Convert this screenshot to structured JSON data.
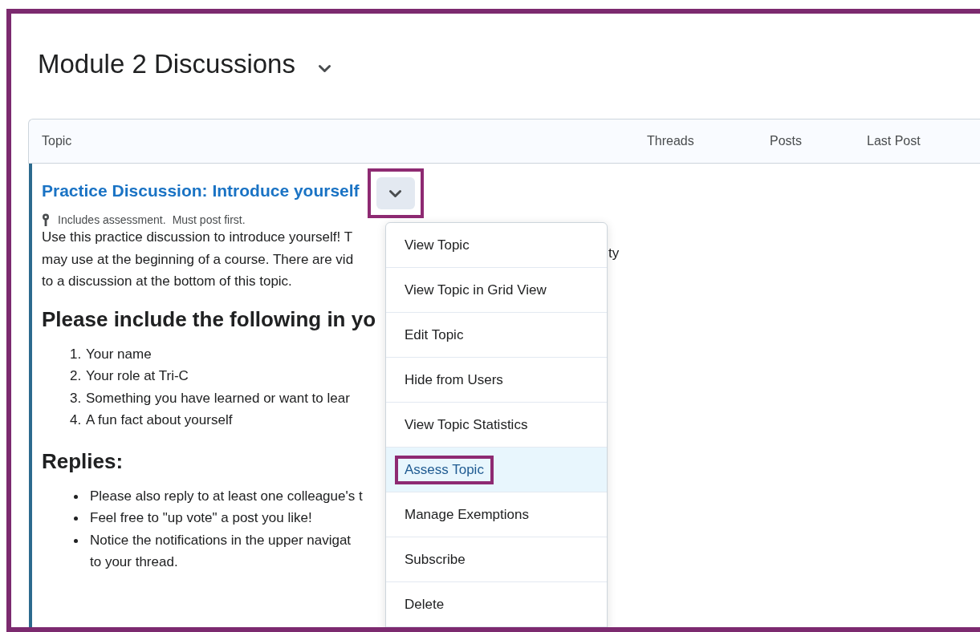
{
  "page": {
    "title": "Module 2 Discussions"
  },
  "table": {
    "columns": [
      "Topic",
      "Threads",
      "Posts",
      "Last Post"
    ]
  },
  "topic": {
    "title": "Practice Discussion: Introduce yourself",
    "menu_button": {
      "highlighted": true
    },
    "meta": [
      "Includes assessment.",
      "Must post first."
    ],
    "intro_lines": [
      "Use this practice discussion to introduce yourself! T",
      "may use at the beginning of a course. There are vid",
      "to a discussion at the bottom of this topic."
    ],
    "intro_fragment": "ty",
    "heading": "Please include the following in yo",
    "numbered": [
      {
        "number": "1.",
        "text": "Your name"
      },
      {
        "number": "2.",
        "text": "Your role at Tri-C"
      },
      {
        "number": "3.",
        "text": "Something you have learned or want to lear"
      },
      {
        "number": "4.",
        "text": "A fun fact about yourself"
      }
    ],
    "replies_heading": "Replies:",
    "bullets": [
      [
        "Please also reply to at least one colleague's t"
      ],
      [
        "Feel free to \"up vote\" a post you like!"
      ],
      [
        "Notice the notifications in the upper navigat",
        "to your thread."
      ]
    ]
  },
  "menu": {
    "items": [
      {
        "label": "View Topic",
        "selected": false,
        "highlighted": false
      },
      {
        "label": "View Topic in Grid View",
        "selected": false,
        "highlighted": false
      },
      {
        "label": "Edit Topic",
        "selected": false,
        "highlighted": false
      },
      {
        "label": "Hide from Users",
        "selected": false,
        "highlighted": false
      },
      {
        "label": "View Topic Statistics",
        "selected": false,
        "highlighted": false
      },
      {
        "label": "Assess Topic",
        "selected": true,
        "highlighted": true
      },
      {
        "label": "Manage Exemptions",
        "selected": false,
        "highlighted": false
      },
      {
        "label": "Subscribe",
        "selected": false,
        "highlighted": false
      },
      {
        "label": "Delete",
        "selected": false,
        "highlighted": false
      }
    ]
  }
}
